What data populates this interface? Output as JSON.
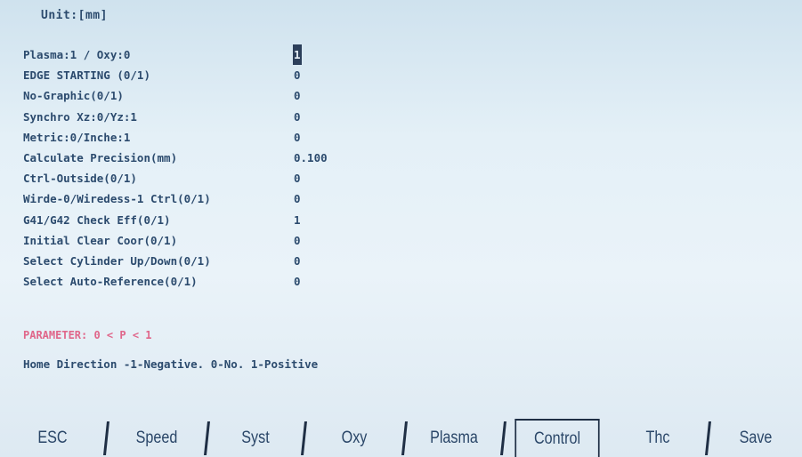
{
  "unit_label": "Unit:[mm]",
  "parameters": [
    {
      "label": "Plasma:1 / Oxy:0",
      "value": "1"
    },
    {
      "label": "EDGE STARTING (0/1)",
      "value": "0"
    },
    {
      "label": "No-Graphic(0/1)",
      "value": "0"
    },
    {
      "label": "Synchro Xz:0/Yz:1",
      "value": "0"
    },
    {
      "label": "Metric:0/Inche:1",
      "value": "0"
    },
    {
      "label": "Calculate Precision(mm)",
      "value": "0.100"
    },
    {
      "label": "Ctrl-Outside(0/1)",
      "value": "0"
    },
    {
      "label": "Wirde-0/Wiredess-1 Ctrl(0/1)",
      "value": "0"
    },
    {
      "label": "G41/G42 Check Eff(0/1)",
      "value": "1"
    },
    {
      "label": "Initial Clear Coor(0/1)",
      "value": "0"
    },
    {
      "label": "Select Cylinder Up/Down(0/1)",
      "value": "0"
    },
    {
      "label": "Select Auto-Reference(0/1)",
      "value": "0"
    }
  ],
  "range_hint": "PARAMETER: 0  < P < 1",
  "help_text": "Home Direction -1-Negative. 0-No. 1-Positive",
  "softkeys": [
    {
      "label": "ESC"
    },
    {
      "label": "Speed"
    },
    {
      "label": "Syst"
    },
    {
      "label": "Oxy"
    },
    {
      "label": "Plasma"
    },
    {
      "label": "Control"
    },
    {
      "label": "Thc"
    },
    {
      "label": "Save"
    }
  ],
  "active_softkey": "Control",
  "colors": {
    "text": "#2c4b6e",
    "range_hint": "#e0668a",
    "cursor_bg": "#2c3f5a"
  }
}
